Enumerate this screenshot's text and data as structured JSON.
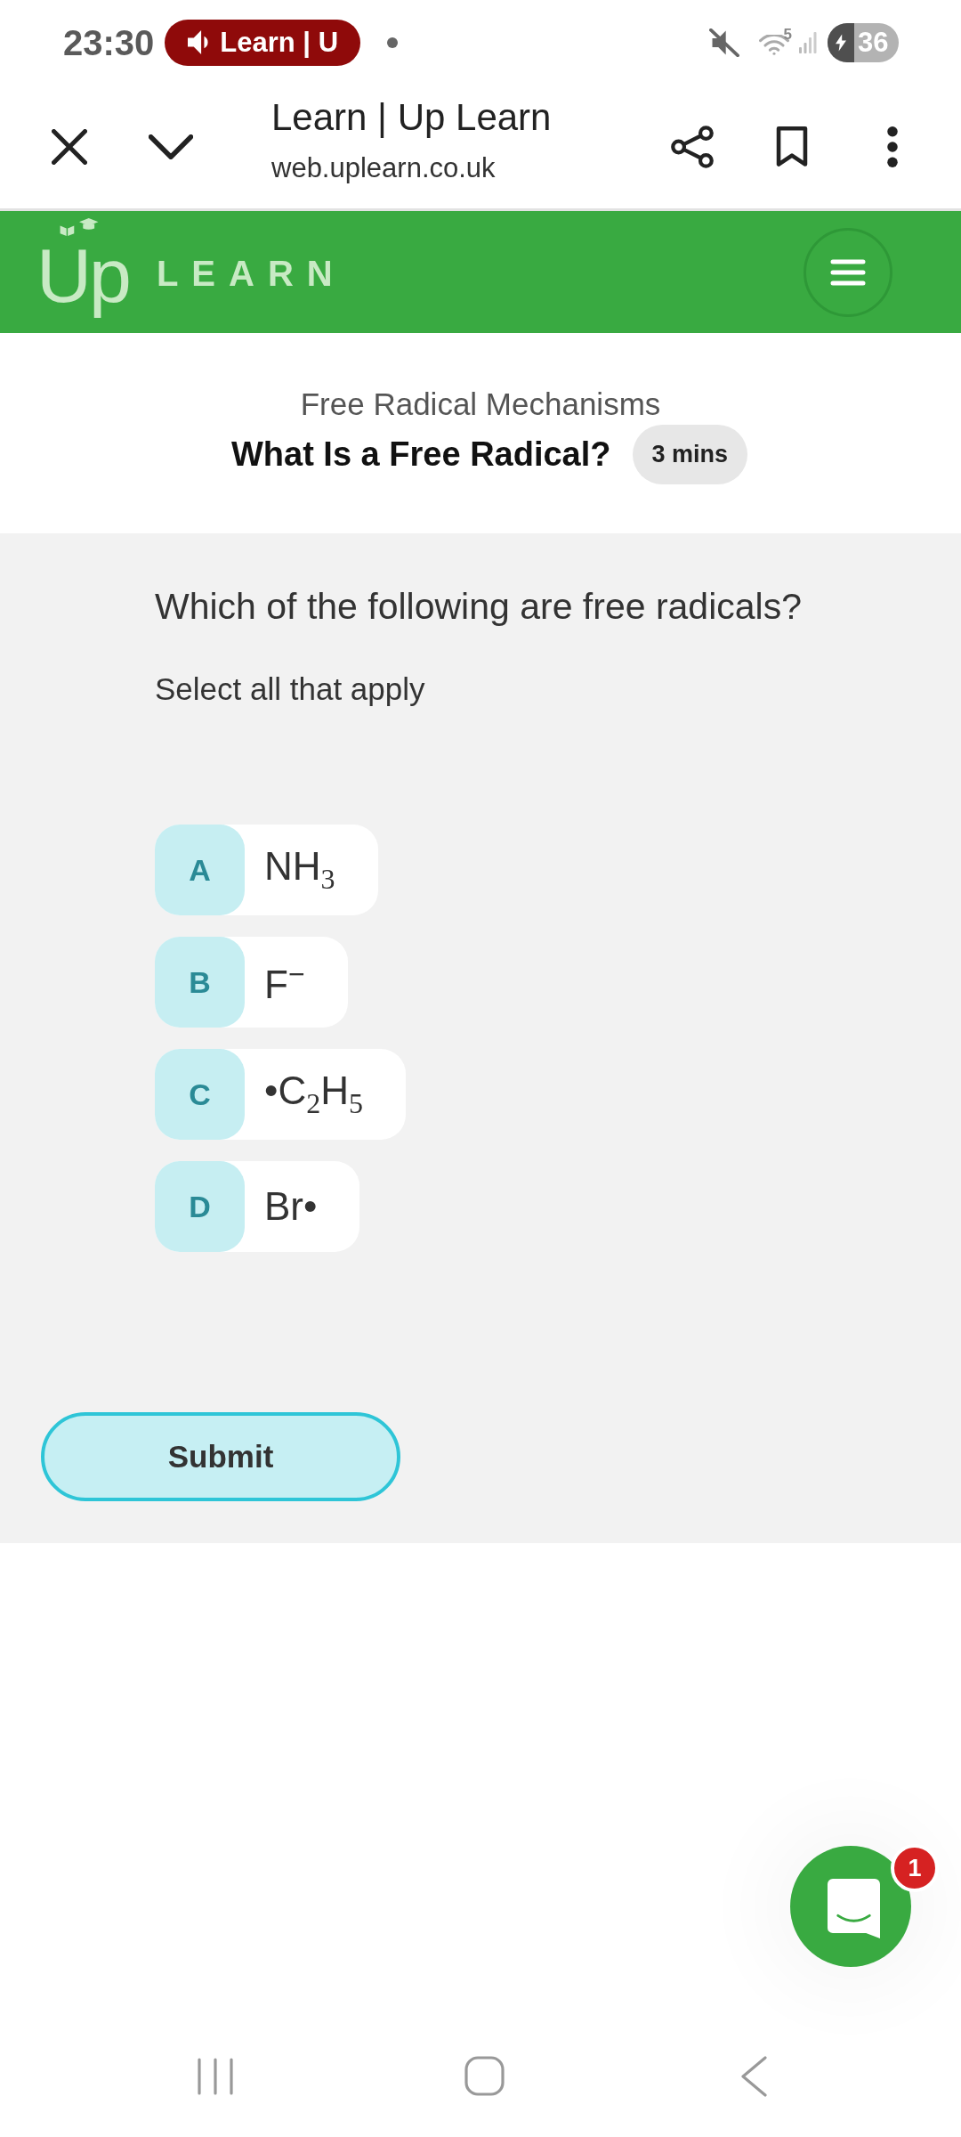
{
  "status_bar": {
    "time": "23:30",
    "media_chip": "Learn | U",
    "wifi_band": "5",
    "battery": "36"
  },
  "browser_bar": {
    "title": "Learn | Up Learn",
    "url": "web.uplearn.co.uk"
  },
  "site_header": {
    "logo_mark": "Up",
    "logo_word": "LEARN"
  },
  "lesson": {
    "topic": "Free Radical Mechanisms",
    "title": "What Is a Free Radical?",
    "duration": "3 mins"
  },
  "question": {
    "prompt": "Which of the following are free radicals?",
    "instruction": "Select all that apply",
    "options": [
      {
        "letter": "A",
        "text": "NH$_{3}$",
        "selected": false
      },
      {
        "letter": "B",
        "text": "F$^{−}$",
        "selected": false
      },
      {
        "letter": "C",
        "text": "•C$_{2}$H$_{5}$",
        "selected": false
      },
      {
        "letter": "D",
        "text": "Br•",
        "selected": false
      }
    ]
  },
  "submit_button": "Submit",
  "chat": {
    "unread": "1"
  }
}
